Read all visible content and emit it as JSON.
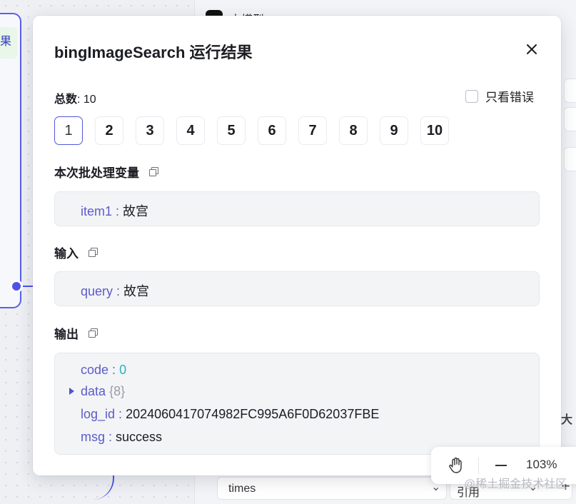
{
  "modal": {
    "title": "bingImageSearch 运行结果",
    "total_label": "总数",
    "total_value": ": 10",
    "errors_only_label": "只看错误",
    "pages": [
      "1",
      "2",
      "3",
      "4",
      "5",
      "6",
      "7",
      "8",
      "9",
      "10"
    ],
    "active_page": "1"
  },
  "batch_vars": {
    "label": "本次批处理变量",
    "items": [
      {
        "key": "item1",
        "value": "故宫"
      }
    ]
  },
  "input": {
    "label": "输入",
    "items": [
      {
        "key": "query",
        "value": "故宫"
      }
    ]
  },
  "output": {
    "label": "输出",
    "code_key": "code",
    "code_value": "0",
    "data_key": "data",
    "data_count": "{8}",
    "log_key": "log_id",
    "log_value": "2024060417074982FC995A6F0D62037FBE",
    "msg_key": "msg",
    "msg_value": "success"
  },
  "zoom": {
    "level": "103%"
  },
  "background": {
    "left_node_char": "果",
    "right_title": "大模型",
    "right_text": "大",
    "times_label": "times",
    "ref_label": "引用"
  },
  "watermark": "@稀土掘金技术社区",
  "colors": {
    "accent": "#5358d8",
    "key": "#5a5dc7",
    "number": "#28b3c1"
  }
}
